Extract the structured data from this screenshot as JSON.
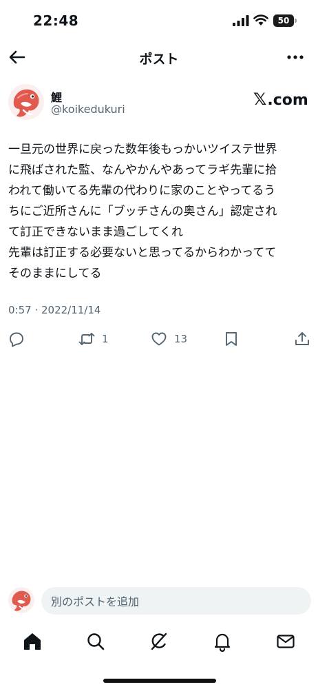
{
  "status_bar": {
    "time": "22:48",
    "battery": "50",
    "icons": [
      "signal-icon",
      "wifi-icon",
      "battery-icon"
    ]
  },
  "header": {
    "title": "ポスト",
    "back_icon": "arrow-left-icon",
    "more_icon": "more-horizontal-icon"
  },
  "author": {
    "display_name": "鯉",
    "username": "@koikedukuri",
    "avatar_icon": "fish-avatar"
  },
  "watermark": {
    "x_mark": "𝕏",
    "domain": ".com"
  },
  "post": {
    "lines": [
      "一旦元の世界に戻った数年後もっかいツイステ世界",
      "に飛ばされた監、なんやかんやあってラギ先輩に拾",
      "われて働いてる先輩の代わりに家のことやってるう",
      "ちにご近所さんに「ブッチさんの奥さん」認定され",
      "て訂正できないまま過ごしてくれ",
      "先輩は訂正する必要ないと思ってるからわかってて",
      "そのままにしてる"
    ],
    "timestamp": "0:57 · 2022/11/14"
  },
  "actions": {
    "reply_count": "",
    "retweet_count": "1",
    "like_count": "13"
  },
  "reply": {
    "placeholder": "別のポストを追加"
  },
  "tabs": [
    "home-icon",
    "search-icon",
    "grok-icon",
    "notifications-icon",
    "messages-icon"
  ],
  "colors": {
    "text": "#0f1419",
    "secondary": "#536471",
    "input_bg": "#eff3f4",
    "avatar_red": "#e05a4f"
  }
}
